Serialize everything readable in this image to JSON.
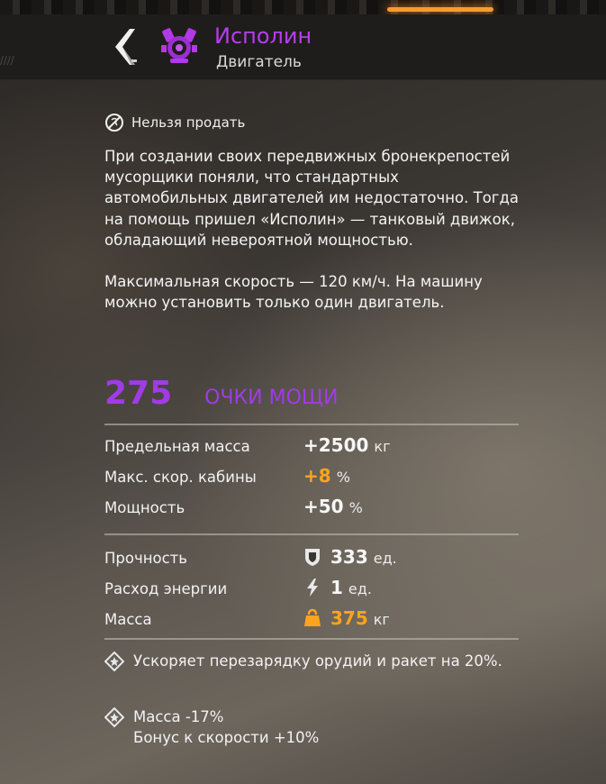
{
  "header": {
    "title": "Исполин",
    "subtitle": "Двигатель"
  },
  "item": {
    "not_sellable": "Нельзя продать",
    "description": [
      "При создании своих передвижных бронекрепостей мусорщики поняли, что стандартных автомобильных двигателей им недостаточно. Тогда на помощь пришел «Исполин» — танковый движок, обладающий невероятной мощностью.",
      "Максимальная скорость — 120 км/ч. На машину можно установить только один двигатель."
    ],
    "power_points": "275",
    "power_label": "ОЧКИ МОЩИ"
  },
  "stats": [
    {
      "name": "Предельная масса",
      "value": "+2500",
      "unit": "кг",
      "color": "#f6f6f6"
    },
    {
      "name": "Макс. скор. кабины",
      "value": "+8",
      "unit": "%",
      "color": "#ffa41c"
    },
    {
      "name": "Мощность",
      "value": "+50",
      "unit": "%",
      "color": "#f6f6f6"
    }
  ],
  "params": [
    {
      "name": "Прочность",
      "icon": "shield-icon",
      "value": "333",
      "unit": "ед.",
      "color": "#f6f6f6"
    },
    {
      "name": "Расход энергии",
      "icon": "lightning-icon",
      "value": "1",
      "unit": "ед.",
      "color": "#f6f6f6"
    },
    {
      "name": "Масса",
      "icon": "weight-icon",
      "value": "375",
      "unit": "кг",
      "color": "#ffa41c"
    }
  ],
  "bonuses": [
    {
      "lines": [
        "Ускоряет перезарядку орудий и ракет на 20%."
      ]
    },
    {
      "lines": [
        "Масса -17%",
        "Бонус к скорости +10%"
      ]
    }
  ],
  "colors": {
    "title": "#b93cf0",
    "power": "#a13be6",
    "accent_orange": "#ffa41c"
  }
}
